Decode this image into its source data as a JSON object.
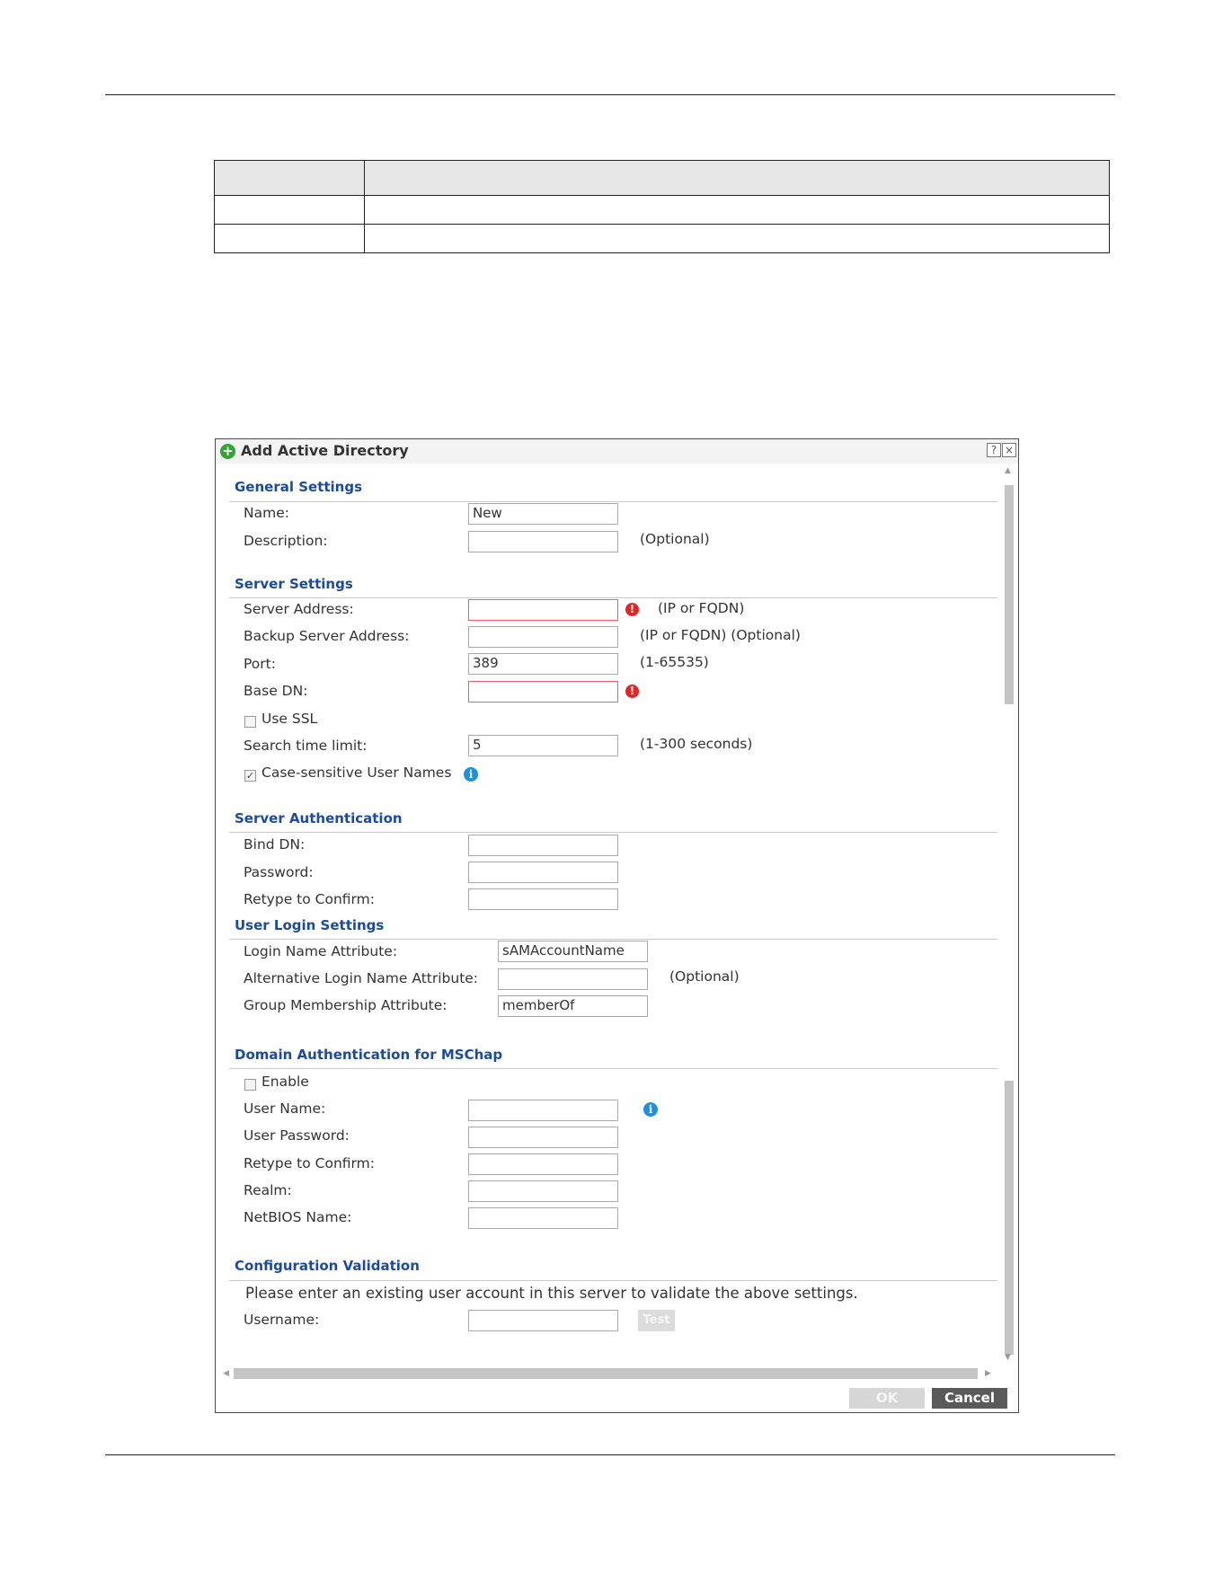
{
  "dialog": {
    "title": "Add Active Directory",
    "help_glyph": "?",
    "close_glyph": "×",
    "title_icon": "add-icon"
  },
  "general": {
    "heading": "General Settings",
    "name_label": "Name:",
    "name_value": "New",
    "description_label": "Description:",
    "description_value": "",
    "description_hint": "(Optional)"
  },
  "server": {
    "heading": "Server Settings",
    "address_label": "Server Address:",
    "address_value": "",
    "address_hint": "(IP or FQDN)",
    "backup_label": "Backup Server Address:",
    "backup_value": "",
    "backup_hint": "(IP or FQDN) (Optional)",
    "port_label": "Port:",
    "port_value": "389",
    "port_hint": "(1-65535)",
    "basedn_label": "Base DN:",
    "basedn_value": "",
    "use_ssl_label": "Use SSL",
    "use_ssl_checked": false,
    "search_label": "Search time limit:",
    "search_value": "5",
    "search_hint": "(1-300 seconds)",
    "case_label": "Case-sensitive User Names",
    "case_checked": true
  },
  "auth": {
    "heading": "Server Authentication",
    "bind_label": "Bind DN:",
    "bind_value": "",
    "password_label": "Password:",
    "password_value": "",
    "retype_label": "Retype to Confirm:",
    "retype_value": ""
  },
  "login": {
    "heading": "User Login Settings",
    "login_attr_label": "Login Name Attribute:",
    "login_attr_value": "sAMAccountName",
    "alt_attr_label": "Alternative Login Name Attribute:",
    "alt_attr_value": "",
    "alt_attr_hint": "(Optional)",
    "group_attr_label": "Group Membership Attribute:",
    "group_attr_value": "memberOf"
  },
  "mschap": {
    "heading": "Domain Authentication for MSChap",
    "enable_label": "Enable",
    "enable_checked": false,
    "user_label": "User Name:",
    "user_value": "",
    "password_label": "User Password:",
    "password_value": "",
    "retype_label": "Retype to Confirm:",
    "retype_value": "",
    "realm_label": "Realm:",
    "realm_value": "",
    "netbios_label": "NetBIOS Name:",
    "netbios_value": ""
  },
  "validation": {
    "heading": "Configuration Validation",
    "instruction": "Please enter an existing user account in this server to validate the above settings.",
    "username_label": "Username:",
    "username_value": "",
    "test_label": "Test"
  },
  "buttons": {
    "ok": "OK",
    "cancel": "Cancel"
  },
  "colors": {
    "section_heading": "#1d4b9b",
    "error": "#e52424",
    "info": "#1f8fe0",
    "add_icon": "#35a33a"
  }
}
